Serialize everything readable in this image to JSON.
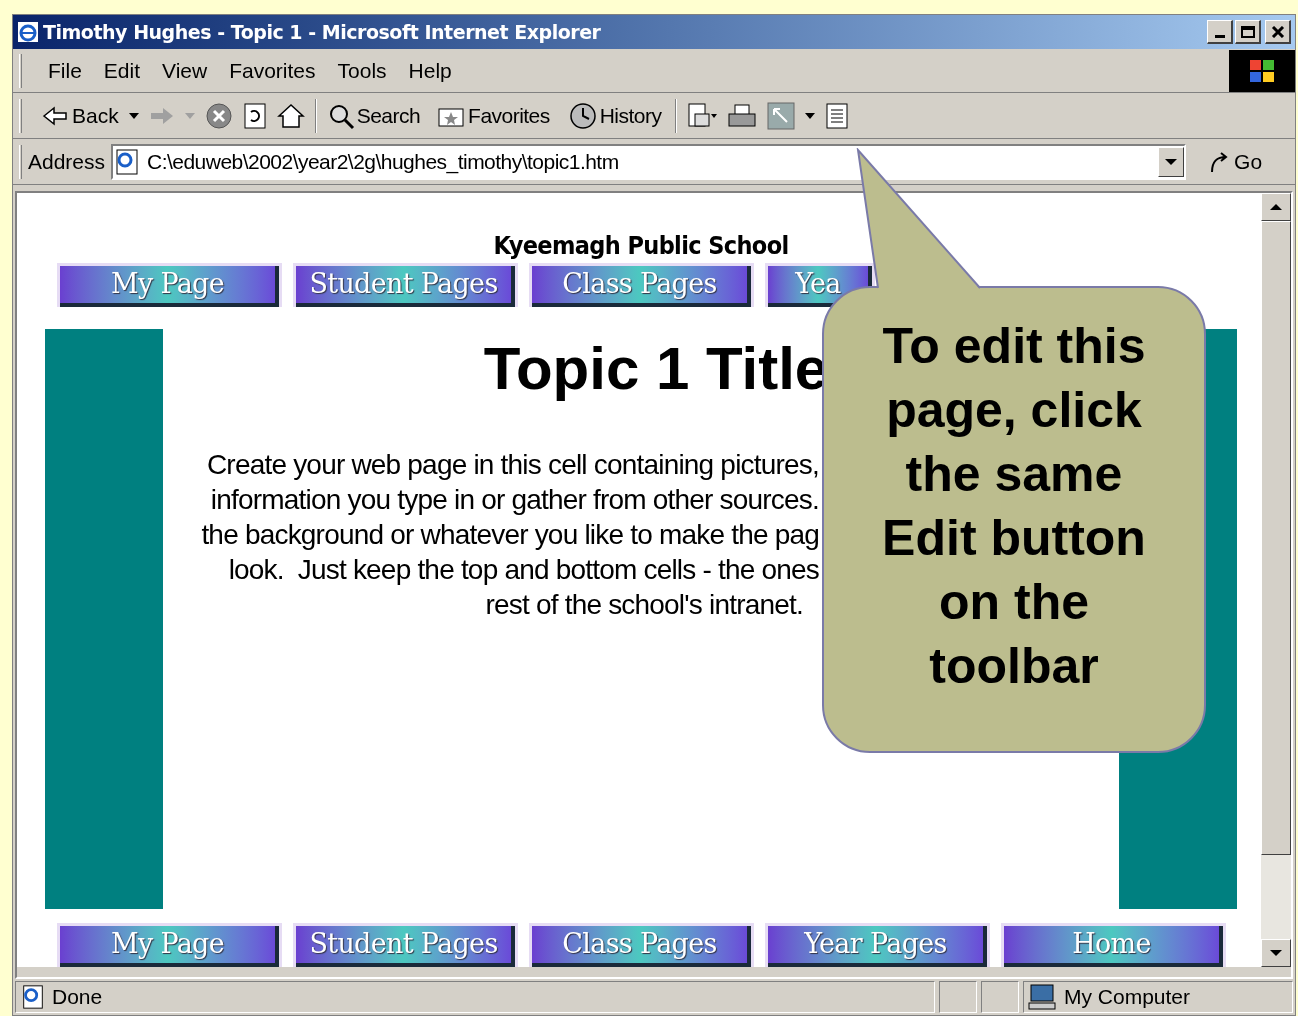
{
  "window": {
    "title": "Timothy Hughes - Topic 1 - Microsoft Internet Explorer"
  },
  "menu": [
    "File",
    "Edit",
    "View",
    "Favorites",
    "Tools",
    "Help"
  ],
  "toolbar": {
    "back": "Back",
    "search": "Search",
    "favorites": "Favorites",
    "history": "History"
  },
  "address": {
    "label": "Address",
    "value": "C:\\eduweb\\2002\\year2\\2g\\hughes_timothy\\topic1.htm",
    "go": "Go"
  },
  "page": {
    "school": "Kyeemagh Public School",
    "nav_top": [
      {
        "label": "My Page"
      },
      {
        "label": "Student Pages"
      },
      {
        "label": "Class Pages"
      },
      {
        "label": "Yea"
      }
    ],
    "title": "Topic 1 Title",
    "body_lines": [
      "Create your web page in this cell containing pictures,",
      "information you type in or gather from other sources.",
      "the background or whatever you like to make the pag",
      "look.  Just keep the top and bottom cells - the ones",
      "rest of the school's intranet."
    ],
    "nav_bottom": [
      {
        "label": "My Page"
      },
      {
        "label": "Student Pages"
      },
      {
        "label": "Class Pages"
      },
      {
        "label": "Year Pages"
      },
      {
        "label": "Home"
      }
    ]
  },
  "callout": {
    "text": "To edit this page, click the same Edit button on the toolbar"
  },
  "status_bar": {
    "text": "Done",
    "zone": "My Computer"
  }
}
